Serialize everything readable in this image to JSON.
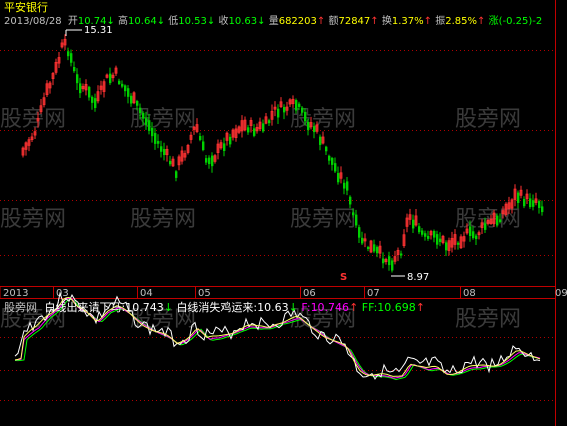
{
  "app": {
    "title": "平安银行"
  },
  "info_bar": {
    "date": "2013/08/28",
    "open_label": "开",
    "open_value": "10.74",
    "high_label": "高",
    "high_value": "10.64",
    "low_label": "低",
    "low_value": "10.53",
    "close_label": "收",
    "close_value": "10.63",
    "volume_label": "量",
    "volume_value": "682203",
    "amount_label": "额",
    "amount_value": "72847",
    "turnover_label": "换",
    "turnover_value": "1.37%",
    "amplitude_label": "振",
    "amplitude_value": "2.85%",
    "change_label": "涨",
    "change_value": "(-0.25)",
    "change_pct_value": "-2"
  },
  "main_chart": {
    "high_marker": "15.31",
    "low_marker": "8.97",
    "signal_marker": "S",
    "time_axis": [
      "2013",
      "03",
      "04",
      "05",
      "06",
      "07",
      "08",
      "09"
    ]
  },
  "indicator_bar": {
    "source": "股旁网",
    "line1_label": "白线出来请下马:",
    "line1_value": "10.743",
    "line2_label": "白线消失鸡运来:",
    "line2_value": "10.63",
    "f_label": "F:",
    "f_value": "10.746",
    "ff_label": "FF:",
    "ff_value": "10.698"
  },
  "watermark": "股旁网",
  "colors": {
    "background": "#000000",
    "up": "#ff3232",
    "down": "#00d200",
    "axis": "#c00000",
    "dotted": "#b00000",
    "white_line": "#ffffff",
    "f_line": "#ff00ff",
    "ff_line": "#00ff00",
    "title_text": "#ffff00",
    "info_text": "#00ff00"
  }
}
